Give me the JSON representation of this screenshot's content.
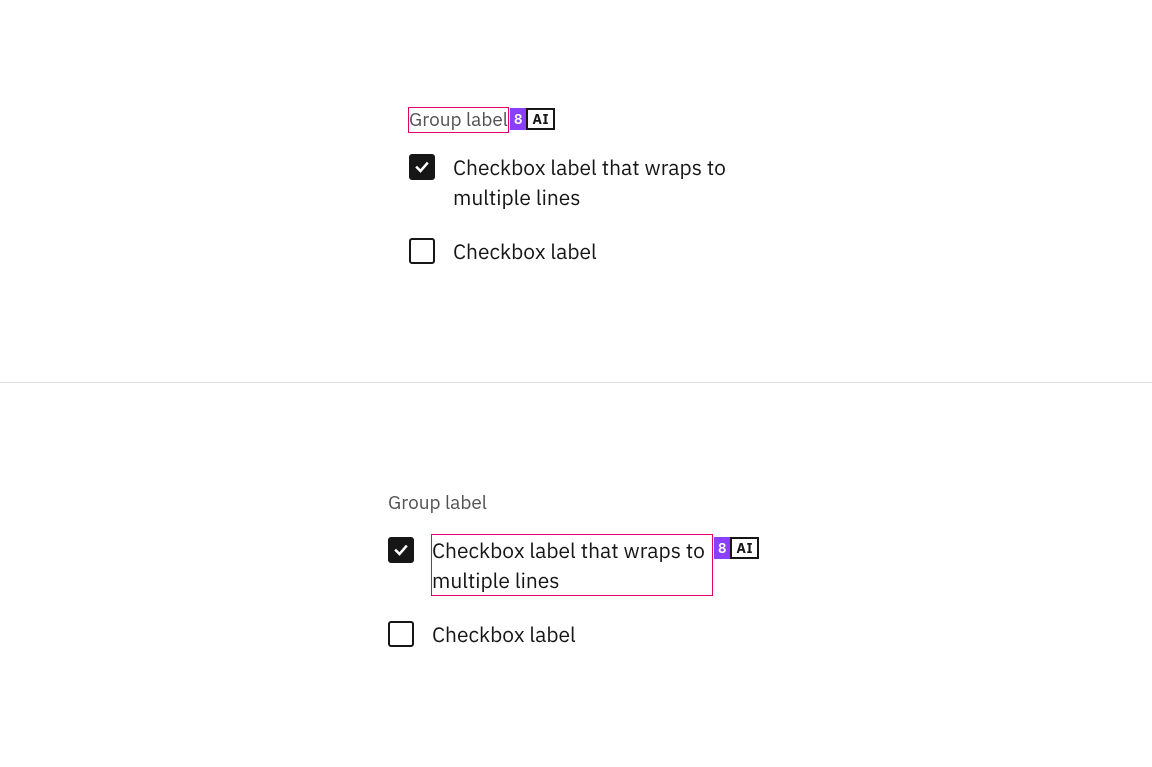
{
  "spec": {
    "badge_number": "8",
    "badge_ai": "AI"
  },
  "group1": {
    "legend": "Group label",
    "options": [
      {
        "label": "Checkbox label that wraps to multiple lines",
        "checked": true
      },
      {
        "label": "Checkbox label",
        "checked": false
      }
    ]
  },
  "group2": {
    "legend": "Group label",
    "options": [
      {
        "label": "Checkbox label that wraps to multiple lines",
        "checked": true
      },
      {
        "label": "Checkbox label",
        "checked": false
      }
    ]
  }
}
